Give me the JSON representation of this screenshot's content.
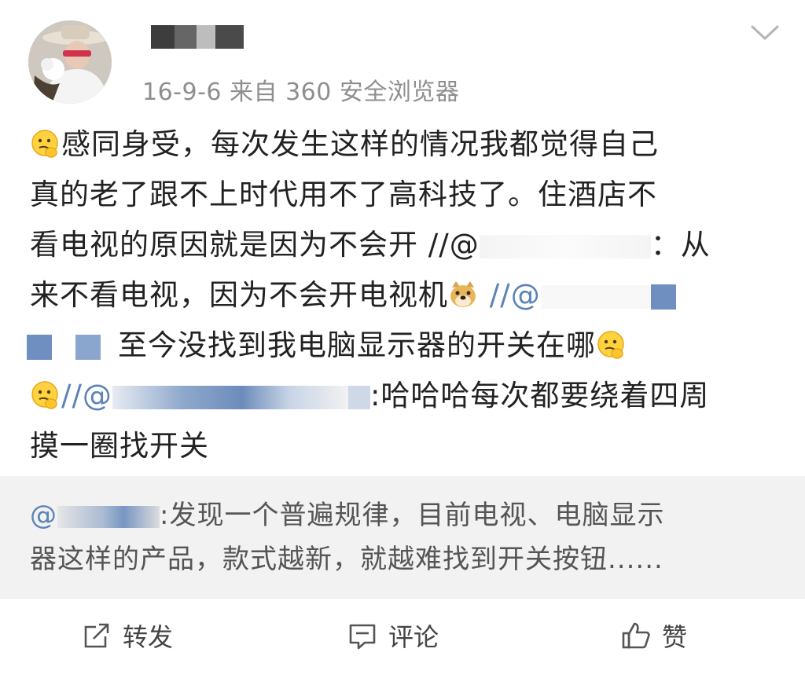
{
  "post": {
    "username": "",
    "meta": "16-9-6  来自 360 安全浏览器",
    "lines": [
      {
        "emoji": "thinking-emoji",
        "text": "感同身受，每次发生这样的情况我都觉得自己"
      },
      {
        "text": "真的老了跟不上时代用不了高科技了。住酒店不"
      },
      {
        "text": "看电视的原因就是因为不会开 //@",
        "suffix": "：从"
      },
      {
        "text": "来不看电视，因为不会开电视机",
        "emoji": "doge-emoji",
        "after": " //@"
      },
      {
        "text": "至今没找到我电脑显示器的开关在哪",
        "emoji": "thinking-emoji"
      },
      {
        "emoji": "thinking-emoji",
        "text": "//@",
        "suffix": ":哈哈哈每次都要绕着四周"
      },
      {
        "text": "摸一圈找开关"
      }
    ]
  },
  "quote": {
    "line1_prefix": "@",
    "line1": ":发现一个普遍规律，目前电视、电脑显示",
    "line2": "器这样的产品，款式越新，就越难找到开关按钮......"
  },
  "actions": {
    "repost": {
      "label": "转发",
      "icon": "share-icon"
    },
    "comment": {
      "label": "评论",
      "icon": "comment-icon"
    },
    "like": {
      "label": "赞",
      "icon": "thumbs-up-icon"
    }
  }
}
